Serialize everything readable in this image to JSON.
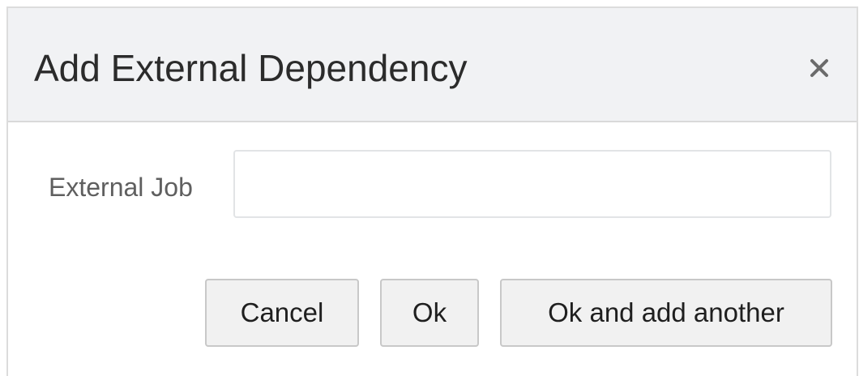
{
  "dialog": {
    "title": "Add External Dependency",
    "close_icon": "close-icon",
    "field": {
      "label": "External Job",
      "value": "",
      "placeholder": ""
    },
    "buttons": {
      "cancel": "Cancel",
      "ok": "Ok",
      "ok_and_add_another": "Ok and add another"
    }
  }
}
